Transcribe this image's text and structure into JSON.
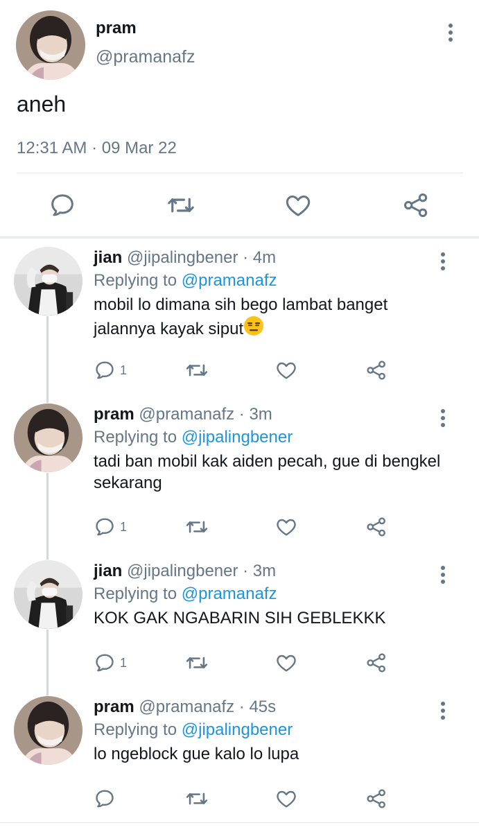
{
  "main_tweet": {
    "name": "pram",
    "handle": "@pramanafz",
    "text": "aneh",
    "timestamp": "12:31 AM · 09 Mar 22"
  },
  "replies": [
    {
      "name": "jian",
      "handle_time": "@jipalingbener · 4m",
      "replying_label": "Replying to",
      "replying_to": "@pramanafz",
      "text": "mobil lo dimana sih bego lambat banget jalannya kayak siput",
      "emoji": "expressionless-face-emoji",
      "reply_count": "1"
    },
    {
      "name": "pram",
      "handle_time": "@pramanafz · 3m",
      "replying_label": "Replying to",
      "replying_to": "@jipalingbener",
      "text": "tadi ban mobil kak aiden pecah, gue di bengkel sekarang",
      "reply_count": "1"
    },
    {
      "name": "jian",
      "handle_time": "@jipalingbener · 3m",
      "replying_label": "Replying to",
      "replying_to": "@pramanafz",
      "text": "KOK GAK NGABARIN SIH GEBLEKKK",
      "reply_count": "1"
    },
    {
      "name": "pram",
      "handle_time": "@pramanafz · 45s",
      "replying_label": "Replying to",
      "replying_to": "@jipalingbener",
      "text": "lo ngeblock gue kalo lo lupa",
      "reply_count": ""
    }
  ],
  "colors": {
    "accent": "#1b95e0",
    "secondary_text": "#657786",
    "icon": "#657786",
    "thread_line": "#cfd9de"
  },
  "icons": [
    "kebab-icon",
    "reply-icon",
    "retweet-icon",
    "like-icon",
    "share-icon"
  ]
}
